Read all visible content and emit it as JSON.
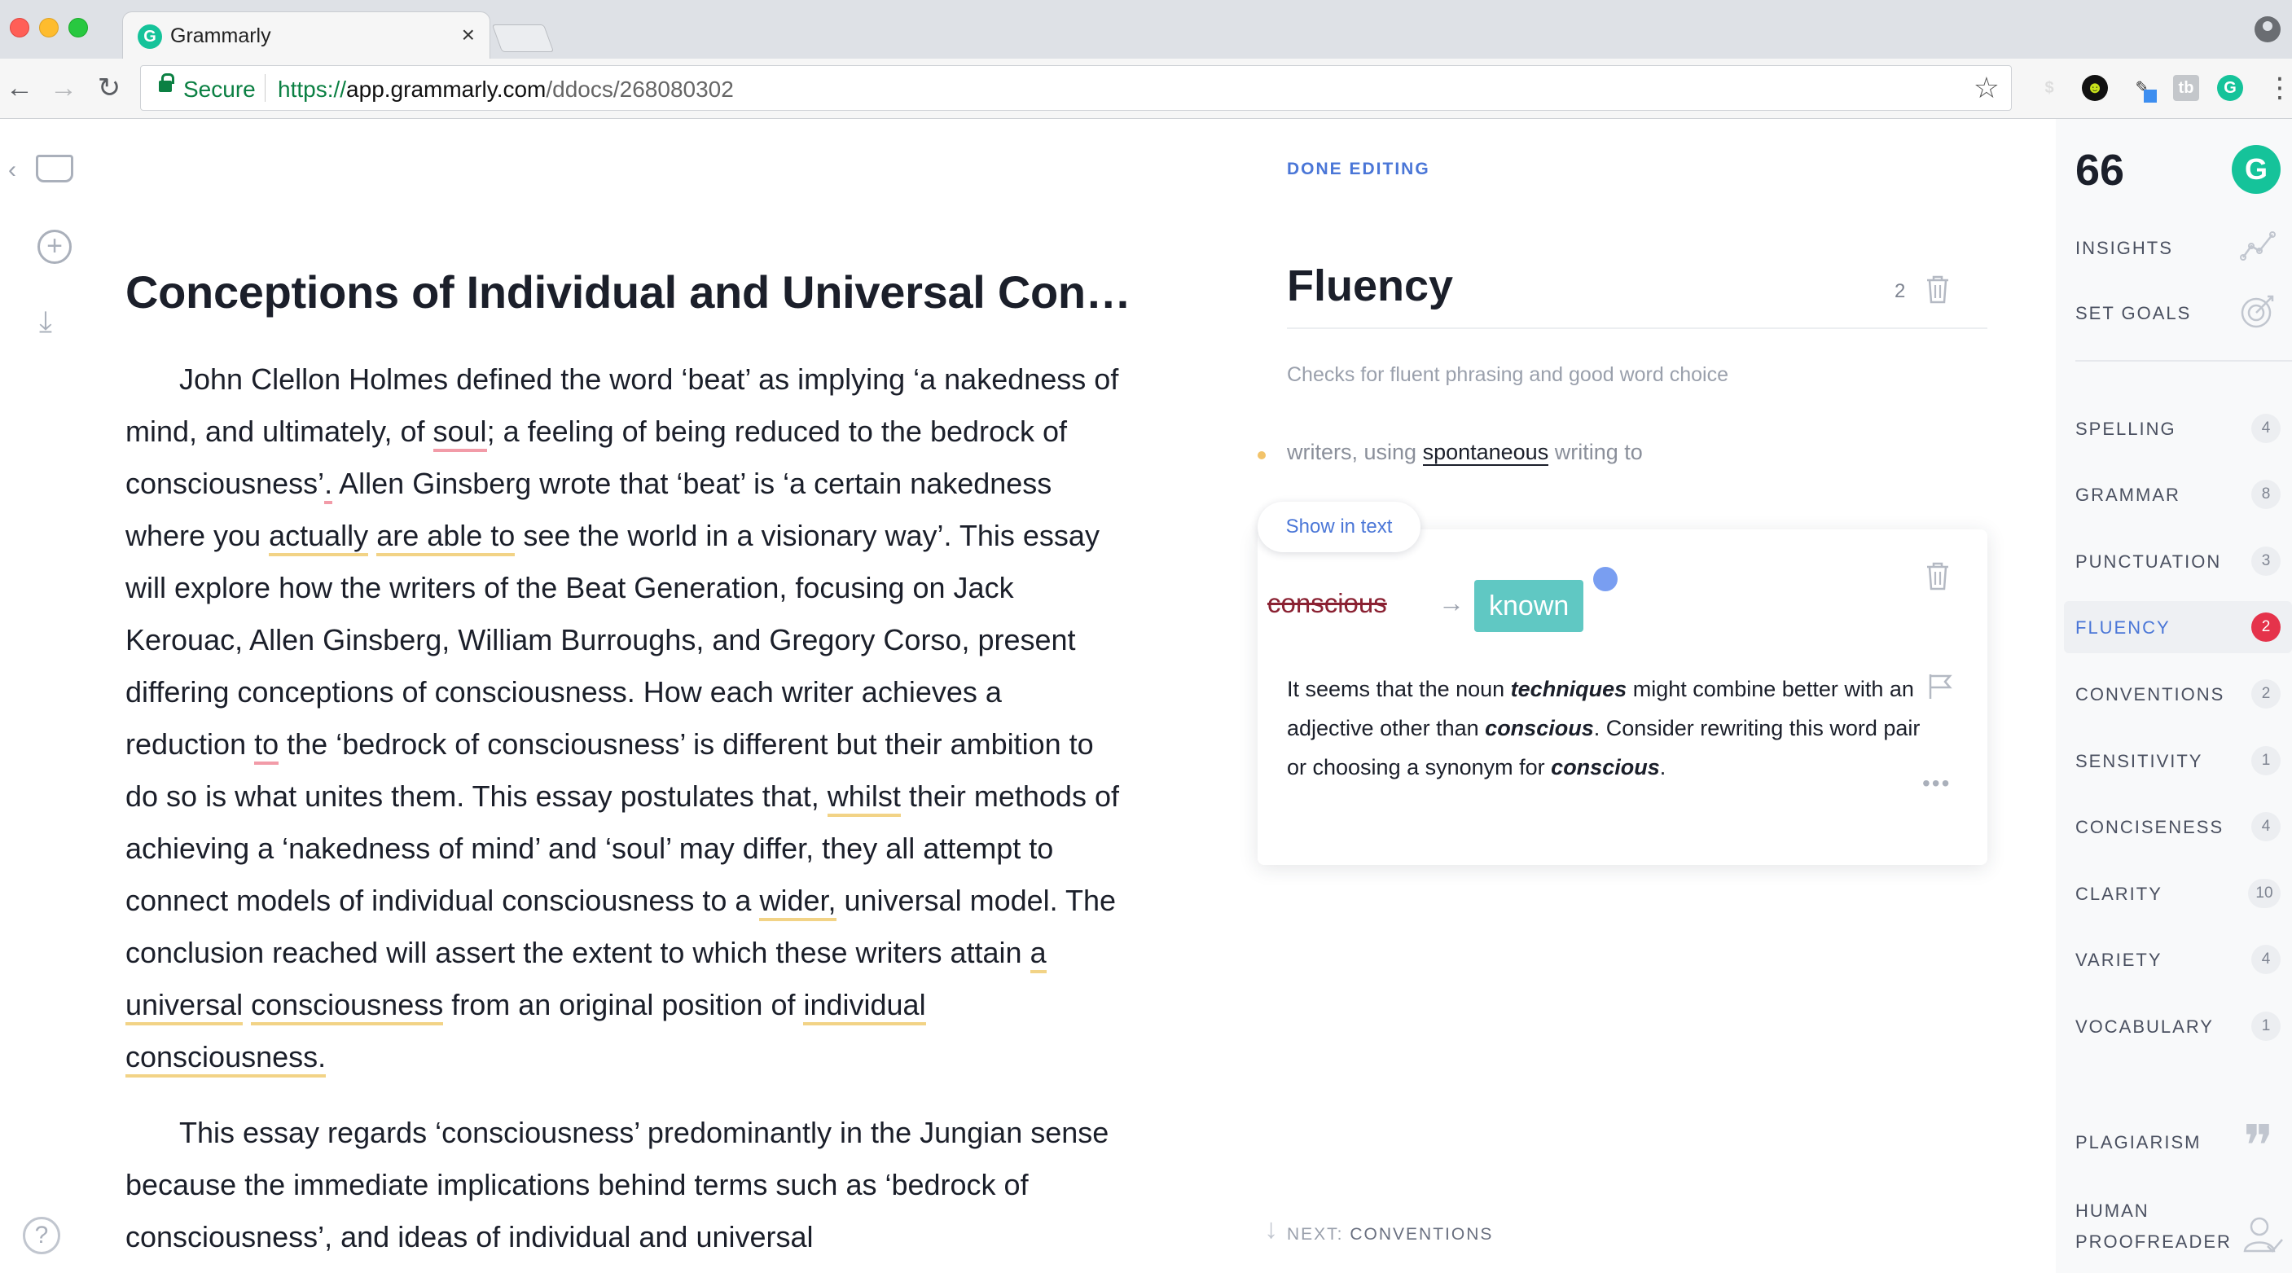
{
  "browser": {
    "tab_title": "Grammarly",
    "tab_favicon_letter": "G",
    "close_glyph": "×",
    "secure_label": "Secure",
    "url_scheme": "https://",
    "url_host": "app.grammarly.com",
    "url_path": "/ddocs/268080302",
    "extensions": [
      "dollar-extension",
      "ghostery-extension",
      "eyedropper-extension",
      "tb-extension",
      "grammarly-extension"
    ],
    "ext_labels": [
      "$",
      "☻",
      "✎",
      "tb",
      "G"
    ],
    "icons": {
      "back": "←",
      "forward": "→",
      "reload": "↻",
      "star": "☆",
      "menu": "⋮"
    }
  },
  "left_rail": {
    "icons": [
      "back-chevron-icon",
      "inbox-icon",
      "add-icon",
      "download-icon",
      "help-icon"
    ],
    "glyphs": {
      "back": "‹",
      "add": "+",
      "download": "⤓",
      "help": "?"
    }
  },
  "document": {
    "title": "Conceptions of Individual and Universal Con…",
    "paragraphs": [
      [
        "John Clellon Holmes defined the word ‘beat’ as implying ‘a nakedness of mind, and ultimately, of ",
        "soul",
        "; a feeling of being reduced to the bedrock of consciousness’",
        ".",
        " Allen Ginsberg wrote that ‘beat’ is ‘a certain nakedness where you ",
        "actually",
        " ",
        "are able to",
        " see the world in a visionary way’. This essay will explore how the writers of the Beat Generation, focusing on Jack Kerouac, Allen Ginsberg, William Burroughs, and Gregory Corso, present differing conceptions of consciousness. How each writer achieves a reduction ",
        "to",
        " the ‘bedrock of consciousness’ is different but their ambition to do so is what unites them. This essay postulates that, ",
        "whilst",
        " their methods of achieving a ‘nakedness of mind’ and ‘soul’ may differ, they all attempt to connect models of individual consciousness to a ",
        "wider,",
        " universal model. The conclusion reached will assert the extent to which these writers attain ",
        "a universal",
        " ",
        "consciousness",
        " from an original position of ",
        "individual",
        " ",
        "consciousness.",
        ""
      ],
      "This essay regards ‘consciousness’ predominantly in the Jungian sense because the immediate implications behind terms such as ‘bedrock of consciousness’, and ideas of individual and universal"
    ]
  },
  "panel": {
    "done_editing": "DONE EDITING",
    "title": "Fluency",
    "count": "2",
    "description": "Checks for fluent phrasing and good word choice",
    "suggestion_before": "writers, using ",
    "suggestion_highlight": "spontaneous",
    "suggestion_after": " writing to",
    "show_in_text": "Show in text",
    "original_word": "conscious",
    "arrow": "→",
    "replacement_word": "known",
    "explanation": {
      "p1": "It seems that the noun ",
      "b1": "techniques",
      "p2": " might combine better with an adjective other than ",
      "b2": "conscious",
      "p3": ". Consider rewriting this word pair or choosing a synonym for ",
      "b3": "conscious",
      "p4": "."
    },
    "more": "•••",
    "next_prefix": "NEXT: ",
    "next_value": "CONVENTIONS",
    "next_arrow": "↓"
  },
  "sidebar": {
    "score": "66",
    "logo_letter": "G",
    "insights": "INSIGHTS",
    "set_goals": "SET GOALS",
    "categories": [
      {
        "label": "SPELLING",
        "count": "4"
      },
      {
        "label": "GRAMMAR",
        "count": "8"
      },
      {
        "label": "PUNCTUATION",
        "count": "3"
      },
      {
        "label": "FLUENCY",
        "count": "2"
      },
      {
        "label": "CONVENTIONS",
        "count": "2"
      },
      {
        "label": "SENSITIVITY",
        "count": "1"
      },
      {
        "label": "CONCISENESS",
        "count": "4"
      },
      {
        "label": "CLARITY",
        "count": "10"
      },
      {
        "label": "VARIETY",
        "count": "4"
      },
      {
        "label": "VOCABULARY",
        "count": "1"
      }
    ],
    "active_category": "FLUENCY",
    "plagiarism": "PLAGIARISM",
    "quote_glyph": "❞",
    "human_proofreader": "HUMAN PROOFREADER"
  },
  "colors": {
    "accent_blue": "#4a76d7",
    "grammarly_green": "#15c39a",
    "error_red": "#e5334b",
    "replacement_teal": "#60c8c3",
    "underline_yellow": "#f2d386",
    "underline_red": "#f29ba8"
  }
}
